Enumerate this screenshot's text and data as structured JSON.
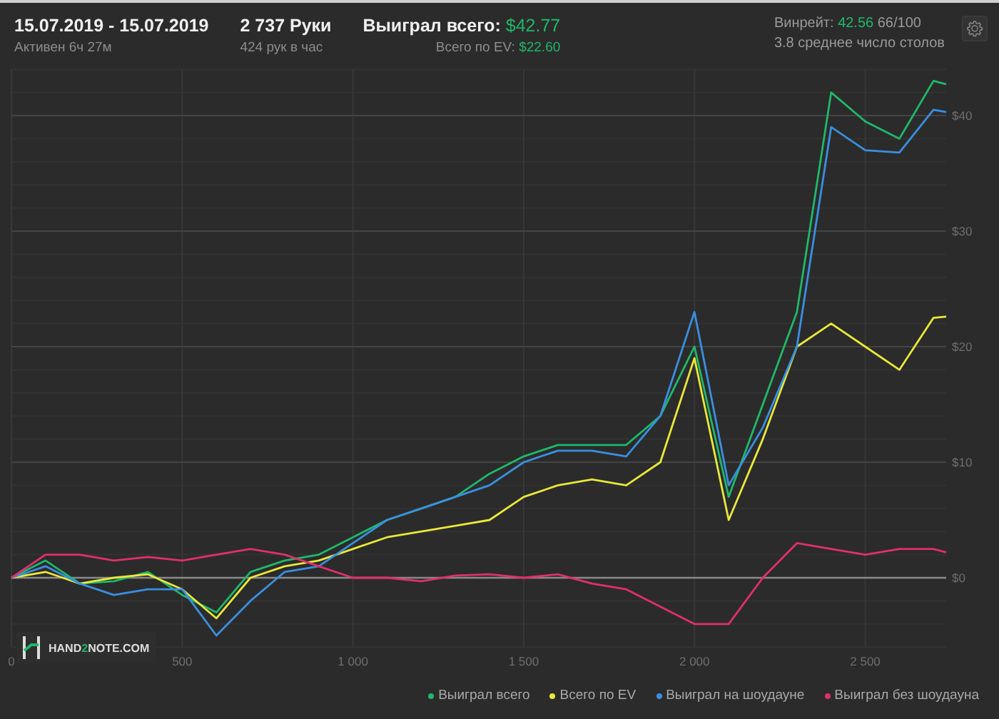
{
  "header": {
    "period": "15.07.2019 - 15.07.2019",
    "active": "Активен 6ч 27м",
    "hands": "2 737 Руки",
    "hands_rate": "424 рук в час",
    "won_label": "Выиграл всего:",
    "won_value": "$42.77",
    "ev_label": "Всего по EV:",
    "ev_value": "$22.60",
    "winrate_label": "Винрейт:",
    "winrate_value": "42.56",
    "winrate_unit": "66/100",
    "tables": "3.8 среднее число столов"
  },
  "logo": {
    "prefix": "HAND",
    "accent": "2",
    "suffix": "NOTE.COM"
  },
  "chart_data": {
    "type": "line",
    "x": [
      0,
      100,
      200,
      300,
      400,
      500,
      600,
      700,
      800,
      900,
      1000,
      1100,
      1200,
      1300,
      1400,
      1500,
      1600,
      1700,
      1800,
      1900,
      2000,
      2100,
      2200,
      2300,
      2400,
      2500,
      2600,
      2700,
      2737
    ],
    "grid": true,
    "xlim": [
      0,
      2737
    ],
    "ylim": [
      -6,
      44
    ],
    "xticks": [
      {
        "value": 0,
        "label": "0"
      },
      {
        "value": 500,
        "label": "500"
      },
      {
        "value": 1000,
        "label": "1 000"
      },
      {
        "value": 1500,
        "label": "1 500"
      },
      {
        "value": 2000,
        "label": "2 000"
      },
      {
        "value": 2500,
        "label": "2 500"
      }
    ],
    "yticks": [
      {
        "value": 0,
        "label": "$0"
      },
      {
        "value": 10,
        "label": "$10"
      },
      {
        "value": 20,
        "label": "$20"
      },
      {
        "value": 30,
        "label": "$30"
      },
      {
        "value": 40,
        "label": "$40"
      }
    ],
    "series": [
      {
        "name": "Выиграл всего",
        "color": "#1fb86b",
        "values": [
          0,
          1.5,
          -0.5,
          -0.3,
          0.5,
          -1.5,
          -3,
          0.5,
          1.5,
          2,
          3.5,
          5,
          6,
          7,
          9,
          10.5,
          11.5,
          11.5,
          11.5,
          14,
          20,
          7,
          15,
          23,
          42,
          39.5,
          38,
          43,
          42.7
        ]
      },
      {
        "name": "Всего по EV",
        "color": "#e8e83a",
        "values": [
          0,
          0.5,
          -0.5,
          0,
          0.3,
          -1,
          -3.5,
          0,
          1,
          1.5,
          2.5,
          3.5,
          4,
          4.5,
          5,
          7,
          8,
          8.5,
          8,
          10,
          19,
          5,
          12,
          20,
          22,
          20,
          18,
          22.5,
          22.6
        ]
      },
      {
        "name": "Выиграл на шоудауне",
        "color": "#3a8fe0",
        "values": [
          0,
          1,
          -0.5,
          -1.5,
          -1,
          -1,
          -5,
          -2,
          0.5,
          1,
          3,
          5,
          6,
          7,
          8,
          10,
          11,
          11,
          10.5,
          14,
          23,
          8,
          13,
          20,
          39,
          37,
          36.8,
          40.5,
          40.3
        ]
      },
      {
        "name": "Выиграл без шоудауна",
        "color": "#e0306a",
        "values": [
          0,
          2,
          2,
          1.5,
          1.8,
          1.5,
          2,
          2.5,
          2,
          1,
          0,
          0,
          -0.3,
          0.2,
          0.3,
          0,
          0.3,
          -0.5,
          -1,
          -2.5,
          -4,
          -4,
          0,
          3,
          2.5,
          2,
          2.5,
          2.5,
          2.2
        ]
      }
    ]
  }
}
